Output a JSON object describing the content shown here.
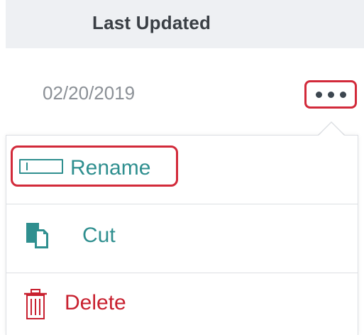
{
  "table": {
    "column_header": "Last Updated",
    "row": {
      "last_updated": "02/20/2019"
    }
  },
  "context_menu": {
    "items": [
      {
        "label": "Rename",
        "icon": "rename-icon",
        "highlighted": true
      },
      {
        "label": "Cut",
        "icon": "cut-icon",
        "highlighted": false
      },
      {
        "label": "Delete",
        "icon": "trash-icon",
        "highlighted": false
      }
    ]
  },
  "colors": {
    "accent_teal": "#2f8f8f",
    "danger_red": "#c8202f",
    "highlight_outline": "#d22a3a",
    "header_bg": "#eef0f3",
    "muted_text": "#8b9096"
  }
}
